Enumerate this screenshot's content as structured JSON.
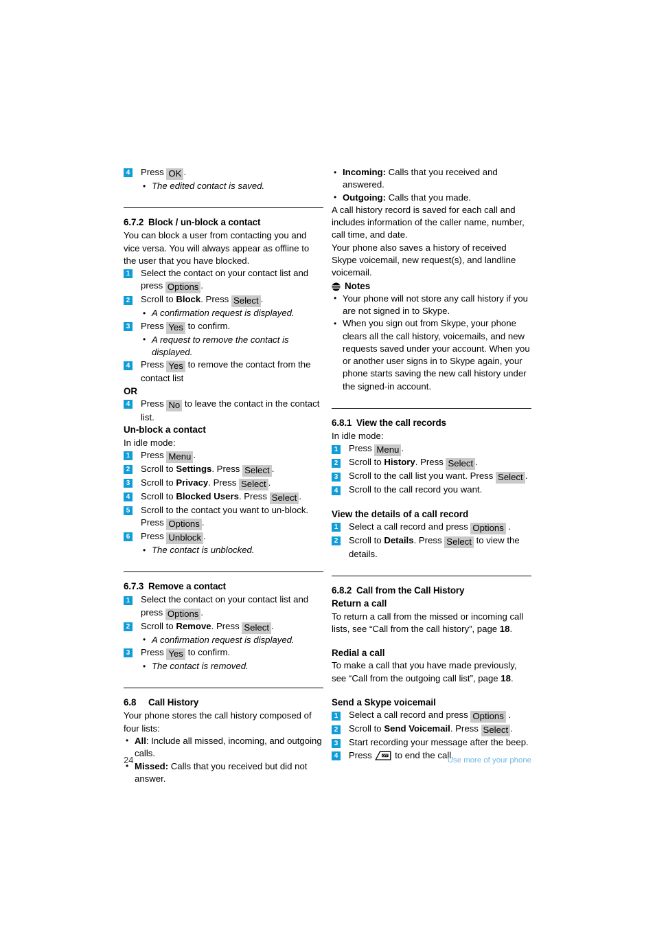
{
  "page": {
    "number": "24",
    "footer_section": "Use more of your phone"
  },
  "left_column": {
    "step4_ok": {
      "badge": "4",
      "text_before": "Press",
      "key": "OK",
      "text_after": ".",
      "note": "The edited contact is saved."
    },
    "section_672": {
      "number": "6.7.2",
      "title": "Block / un-block a contact",
      "intro": "You can block a user from contacting you and vice versa. You will always appear as offline to the user that you have blocked.",
      "steps": [
        {
          "badge": "1",
          "text_before": "Select the contact on your contact list and press",
          "key": "Options",
          "text_after": "."
        },
        {
          "badge": "2",
          "text_before": "Scroll to",
          "bold": "Block",
          "mid": ". Press",
          "key": "Select",
          "text_after": ".",
          "note": "A confirmation request is displayed."
        },
        {
          "badge": "3",
          "text_before": "Press",
          "key": "Yes",
          "text_after": "to confirm.",
          "note": "A request to remove the contact is displayed."
        },
        {
          "badge": "4",
          "text_before": "Press",
          "key": "Yes",
          "text_after": "to remove the contact from the contact list"
        }
      ],
      "or_label": "OR",
      "or_step": {
        "badge": "4",
        "text_before": "Press",
        "key": "No",
        "text_after": "to leave the contact in the contact list."
      }
    },
    "unblock": {
      "heading": "Un-block a contact",
      "idle": "In idle mode:",
      "steps": [
        {
          "badge": "1",
          "text_before": "Press",
          "key": "Menu",
          "text_after": "."
        },
        {
          "badge": "2",
          "text_before": "Scroll to",
          "bold": "Settings",
          "mid": ". Press",
          "key": "Select",
          "text_after": "."
        },
        {
          "badge": "3",
          "text_before": "Scroll to",
          "bold": "Privacy",
          "mid": ". Press",
          "key": "Select",
          "text_after": "."
        },
        {
          "badge": "4",
          "text_before": "Scroll to",
          "bold": "Blocked Users",
          "mid": ". Press",
          "key": "Select",
          "text_after": "."
        },
        {
          "badge": "5",
          "text_before": "Scroll to the contact you want to un-block. Press",
          "key": "Options",
          "text_after": "."
        },
        {
          "badge": "6",
          "text_before": "Press",
          "key": "Unblock",
          "text_after": ".",
          "note": "The contact is unblocked."
        }
      ]
    },
    "section_673": {
      "number": "6.7.3",
      "title": "Remove a contact",
      "steps": [
        {
          "badge": "1",
          "text_before": "Select the contact on your contact list and press",
          "key": "Options",
          "text_after": "."
        },
        {
          "badge": "2",
          "text_before": "Scroll to",
          "bold": "Remove",
          "mid": ". Press",
          "key": "Select",
          "text_after": ".",
          "note": "A confirmation request is displayed."
        },
        {
          "badge": "3",
          "text_before": "Press",
          "key": "Yes",
          "text_after": "to confirm.",
          "note": "The contact is removed."
        }
      ]
    },
    "section_68": {
      "number": "6.8",
      "title": "Call History",
      "intro": "Your phone stores the call history composed of four lists:",
      "bullets": [
        {
          "bold": "All",
          "text": ":  Include all missed, incoming, and outgoing calls."
        },
        {
          "bold": "Missed:",
          "text": " Calls that you received but did not answer."
        }
      ]
    }
  },
  "right_column": {
    "call_history_bullets": [
      {
        "bold": "Incoming:",
        "text": " Calls that you received and answered."
      },
      {
        "bold": "Outgoing:",
        "text": " Calls that you made."
      }
    ],
    "para1": "A call history record is saved for each call and includes information of the caller name, number, call time, and date.",
    "para2": "Your phone also saves a history of received Skype voicemail, new request(s), and landline voicemail.",
    "notes": {
      "icon": "notes-icon",
      "heading": "Notes",
      "items": [
        "Your phone will not store any call history if you are not signed in to Skype.",
        "When you sign out from Skype, your phone clears all the call history, voicemails, and new requests saved under your account. When you or another user signs in to Skype again, your phone starts saving the new call history under the signed-in account."
      ]
    },
    "section_681": {
      "number": "6.8.1",
      "title": "View the call records",
      "idle": "In idle mode:",
      "steps": [
        {
          "badge": "1",
          "text_before": "Press",
          "key": "Menu",
          "text_after": "."
        },
        {
          "badge": "2",
          "text_before": "Scroll to",
          "bold": "History",
          "mid": ". Press",
          "key": "Select",
          "text_after": "."
        },
        {
          "badge": "3",
          "text_before": "Scroll to the call list you want. Press",
          "key": "Select",
          "text_after": "."
        },
        {
          "badge": "4",
          "text_before": "Scroll to the call record you want."
        }
      ],
      "details_heading": "View the details of a call record",
      "details_steps": [
        {
          "badge": "1",
          "text_before": "Select a call record and press",
          "key": "Options",
          "text_after": "."
        },
        {
          "badge": "2",
          "text_before": "Scroll to",
          "bold": "Details",
          "mid": ". Press",
          "key": "Select",
          "text_after": "to view the details."
        }
      ]
    },
    "section_682": {
      "number": "6.8.2",
      "title": "Call from the Call History",
      "return_heading": "Return a call",
      "return_text_1": "To return a call from the missed or incoming call lists, see “Call from the call history”, page ",
      "return_page": "18",
      "return_text_2": ".",
      "redial_heading": "Redial a call",
      "redial_text_1": "To make a call that you have made previously, see “Call from the outgoing call list”, page ",
      "redial_page": "18",
      "redial_text_2": ".",
      "voicemail_heading": "Send a Skype voicemail",
      "voicemail_steps": [
        {
          "badge": "1",
          "text_before": "Select a call record and press",
          "key": "Options",
          "text_after": "."
        },
        {
          "badge": "2",
          "text_before": "Scroll to",
          "bold": "Send Voicemail",
          "mid": ". Press",
          "key": "Select",
          "text_after": "."
        },
        {
          "badge": "3",
          "text_before": "Start recording your message after the beep."
        },
        {
          "badge": "4",
          "text_before": "Press",
          "icon": "end-call-key-icon",
          "text_after": "to end the call."
        }
      ]
    }
  },
  "colors": {
    "badge_blue": "#0f9cd7",
    "key_gray": "#c9c9c9",
    "footer_blue": "#6db7e8"
  }
}
